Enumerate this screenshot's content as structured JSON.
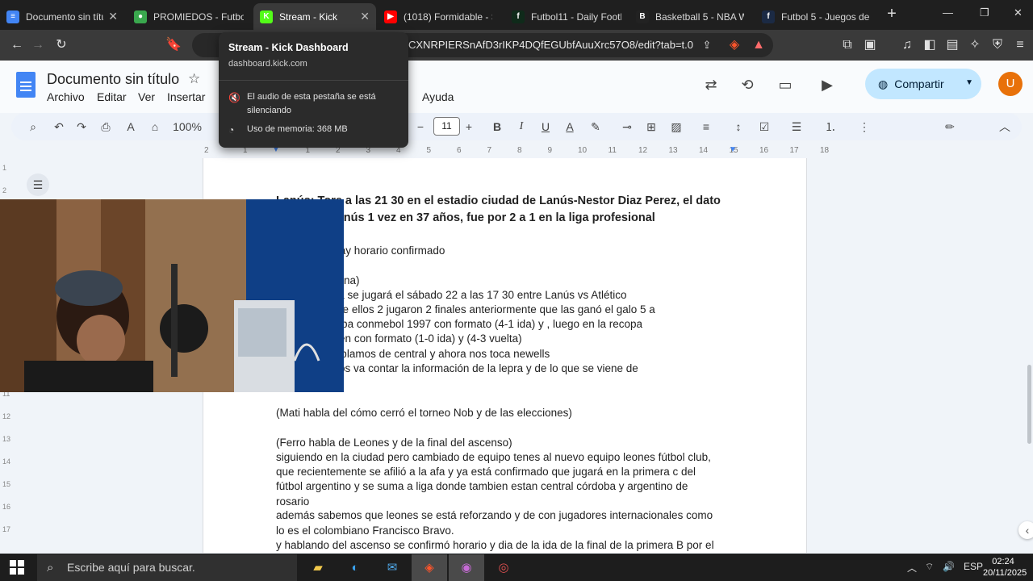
{
  "browser": {
    "tabs": [
      {
        "title": "Documento sin títu",
        "favicon": "google-docs-icon",
        "color": "#4285f4",
        "glyph": "≡",
        "active": false
      },
      {
        "title": "PROMIEDOS - Futbol",
        "favicon": "promiedos-icon",
        "color": "#3aa84e",
        "glyph": "●",
        "active": false
      },
      {
        "title": "Stream - Kick",
        "favicon": "kick-icon",
        "color": "#53fc18",
        "glyph": "K",
        "active": true
      },
      {
        "title": "(1018) Formidable - S",
        "favicon": "youtube-icon",
        "color": "#ff0000",
        "glyph": "▶",
        "active": false
      },
      {
        "title": "Futbol11 - Daily Footl",
        "favicon": "futbol11-icon",
        "color": "#0f2a1a",
        "glyph": "f",
        "active": false
      },
      {
        "title": "Basketball 5 - NBA W",
        "favicon": "basketball5-icon",
        "color": "#222222",
        "glyph": "B",
        "active": false
      },
      {
        "title": "Futbol 5 - Juegos de f",
        "favicon": "futbol5-icon",
        "color": "#1b2a44",
        "glyph": "f",
        "active": false
      }
    ],
    "new_tab": "+",
    "url": "CXNRPIERSnAfD3rIKP4DQfEGUbfAuuXrc57O8/edit?tab=t.0"
  },
  "hovercard": {
    "title": "Stream - Kick Dashboard",
    "domain": "dashboard.kick.com",
    "mute_notice": "El audio de esta pestaña se está silenciando",
    "memory": "Uso de memoria: 368 MB"
  },
  "docs": {
    "title": "Documento sin título",
    "menus": [
      "Archivo",
      "Editar",
      "Ver",
      "Insertar",
      "Ayuda"
    ],
    "share_label": "Compartir",
    "avatar_letter": "U",
    "zoom": "100%",
    "font_size": "11",
    "ruler_numbers": [
      "2",
      "1",
      "1",
      "2",
      "3",
      "4",
      "5",
      "6",
      "7",
      "8",
      "9",
      "10",
      "11",
      "12",
      "13",
      "14",
      "15",
      "16",
      "17",
      "18"
    ],
    "vruler_numbers": [
      "1",
      "2",
      "3",
      "4",
      "5",
      "6",
      "7",
      "8",
      "9",
      "10",
      "11",
      "12",
      "13",
      "14",
      "15",
      "16",
      "17"
    ],
    "lines": [
      {
        "text": "Lanús: Tore a las 21 30 en el estadio ciudad de Lanús-Nestor Diaz Perez, el dato",
        "bold": true
      },
      {
        "text": "le ganó a Lanús 1 vez en 37 años, fue por 2 a 1 en la liga profesional",
        "bold": true
      },
      {
        "text": "2",
        "bold": true
      },
      {
        "text": "a la final, si hay horario confirmado",
        "bold": false
      },
      {
        "text": "",
        "bold": false
      },
      {
        "text": "la sudamericana)",
        "bold": false
      },
      {
        "text": "sudamericana se jugará el sábado 22 a las 17 30 entre Lanús vs Atlético",
        "bold": false
      },
      {
        "text": "to es que entre ellos 2 jugaron 2 finales anteriormente que las ganó el galo 5 a",
        "bold": false
      },
      {
        "text": ", una en la copa conmebol 1997 con formato (4-1 ida) y , luego en la recopa",
        "bold": false
      },
      {
        "text": "a 2014 también con formato (1-0 ida) y (4-3 vuelta)",
        "bold": false
      },
      {
        "text": "ciudad, ya hablamos de central y ahora nos toca newells",
        "bold": false
      },
      {
        "text": "tá mati que nos va contar la información de la lepra y de lo que se viene de",
        "bold": false
      },
      {
        "text": "cciones",
        "bold": false
      },
      {
        "text": "",
        "bold": false
      },
      {
        "text": "(Mati habla del cómo cerró el torneo Nob y de las elecciones)",
        "bold": false
      },
      {
        "text": "",
        "bold": false
      },
      {
        "text": "(Ferro habla de Leones y de la final del ascenso)",
        "bold": false
      },
      {
        "text": " siguiendo en la ciudad pero cambiado de equipo tenes al nuevo equipo leones fútbol club,",
        "bold": false
      },
      {
        "text": "que recientemente se afilió a la afa y ya está confirmado que jugará en la primera c del",
        "bold": false
      },
      {
        "text": "fútbol argentino y se suma a liga donde tambien estan central córdoba y argentino de",
        "bold": false
      },
      {
        "text": "rosario",
        "bold": false
      },
      {
        "text": "además sabemos que leones se está reforzando y de con jugadores internacionales como",
        "bold": false
      },
      {
        "text": "lo es el colombiano Francisco Bravo.",
        "bold": false
      },
      {
        "text": "y hablando del ascenso se confirmó horario y dia de la ida de la  final de la primera B por el",
        "bold": false
      }
    ]
  },
  "taskbar": {
    "search_placeholder": "Escribe aquí para buscar.",
    "language": "ESP",
    "time": "02:24",
    "date": "20/11/2025"
  }
}
